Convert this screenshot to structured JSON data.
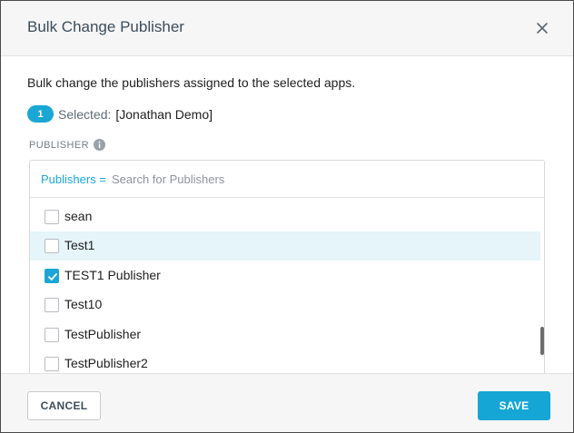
{
  "dialog": {
    "title": "Bulk Change Publisher",
    "description": "Bulk change the publishers assigned to the selected apps."
  },
  "selection": {
    "count": "1",
    "label": "Selected:",
    "value": "[Jonathan Demo]"
  },
  "publisher_field": {
    "label": "PUBLISHER",
    "search_prefix": "Publishers =",
    "search_placeholder": "Search for Publishers",
    "search_value": "",
    "options": [
      {
        "label": "sean",
        "checked": false
      },
      {
        "label": "Test1",
        "checked": false,
        "hovered": true
      },
      {
        "label": "TEST1 Publisher",
        "checked": true
      },
      {
        "label": "Test10",
        "checked": false
      },
      {
        "label": "TestPublisher",
        "checked": false
      },
      {
        "label": "TestPublisher2",
        "checked": false
      }
    ]
  },
  "footer": {
    "cancel_label": "CANCEL",
    "save_label": "SAVE"
  },
  "colors": {
    "accent": "#1aa7d6",
    "hover_row": "#e5f5f9"
  },
  "icons": {
    "close": "close-icon",
    "info": "info-icon",
    "check": "checkmark-icon"
  }
}
